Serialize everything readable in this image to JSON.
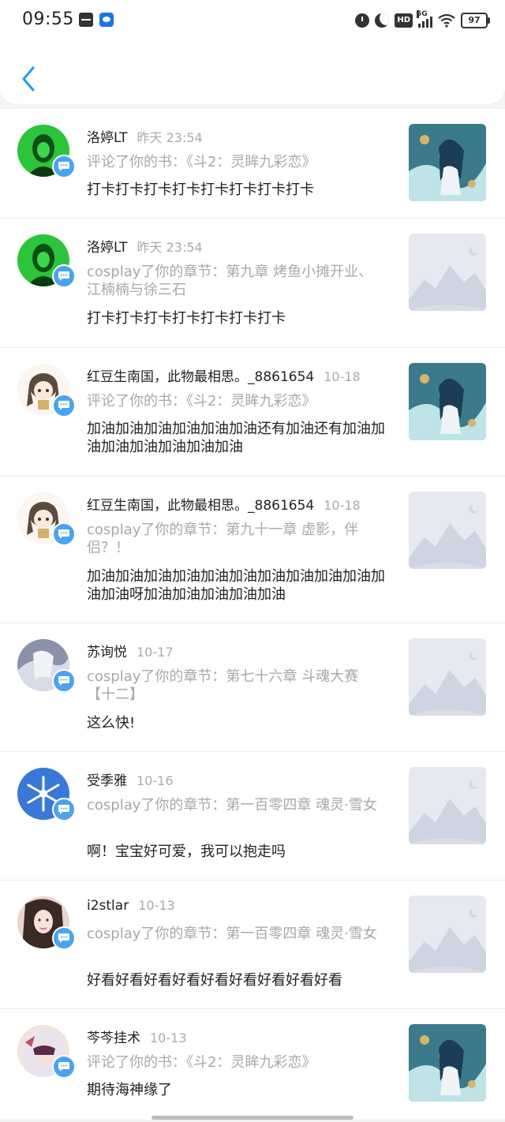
{
  "status_bar": {
    "time": "09:55",
    "battery": "97",
    "network": "5G"
  },
  "notifications": [
    {
      "user": "洛婷LT",
      "time": "昨天 23:54",
      "action": "评论了你的书：《斗2：灵眸九彩恋》",
      "content": "打卡打卡打卡打卡打卡打卡打卡打卡",
      "avatar": "green-girl",
      "thumb": "cover-art"
    },
    {
      "user": "洛婷LT",
      "time": "昨天 23:54",
      "action": "cosplay了你的章节：第九章 烤鱼小摊开业、江楠楠与徐三石",
      "content": "打卡打卡打卡打卡打卡打卡打卡",
      "avatar": "green-girl",
      "thumb": "placeholder"
    },
    {
      "user": "红豆生南国，此物最相思。_8861654",
      "time": "10-18",
      "action": "评论了你的书：《斗2：灵眸九彩恋》",
      "content": "加油加油加油加油加油加油还有加油还有加油加油加油加油加油加油加油",
      "avatar": "chibi-girl",
      "thumb": "cover-art"
    },
    {
      "user": "红豆生南国，此物最相思。_8861654",
      "time": "10-18",
      "action": "cosplay了你的章节：第九十一章 虚影，伴侣？！",
      "content": "加油加油加油加油加油加油加油加油加油加油加油加油呀加油加油加油加油加油",
      "avatar": "chibi-girl",
      "thumb": "placeholder"
    },
    {
      "user": "苏询悦",
      "time": "10-17",
      "action": "cosplay了你的章节：第七十六章 斗魂大赛【十二】",
      "content": "这么快!",
      "avatar": "hand-photo",
      "thumb": "placeholder"
    },
    {
      "user": "受季雅",
      "time": "10-16",
      "action": "cosplay了你的章节：第一百零四章 魂灵·雪女",
      "content": "啊！宝宝好可爱，我可以抱走吗",
      "avatar": "snowflake",
      "thumb": "placeholder"
    },
    {
      "user": "i2stlar",
      "time": "10-13",
      "action": "cosplay了你的章节：第一百零四章 魂灵·雪女",
      "content": "好看好看好看好看好看好看好看好看好看",
      "avatar": "portrait-girl",
      "thumb": "placeholder"
    },
    {
      "user": "芩芩挂术",
      "time": "10-13",
      "action": "评论了你的书：《斗2：灵眸九彩恋》",
      "content": "期待海神缘了",
      "avatar": "anime-mask",
      "thumb": "cover-art"
    }
  ]
}
